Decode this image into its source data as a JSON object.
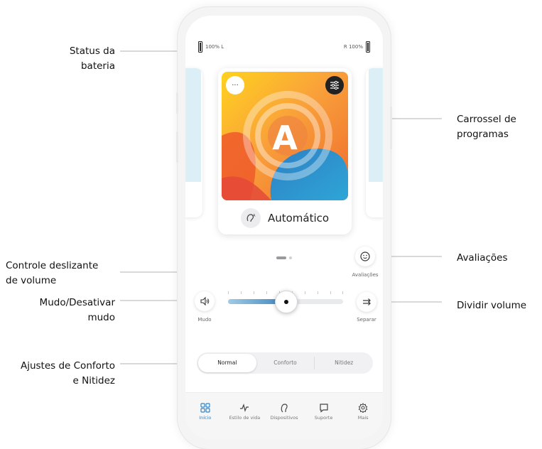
{
  "callouts": {
    "battery_status": "Status da\nbateria",
    "program_carousel": "Carrossel de\nprogramas",
    "ratings": "Avaliações",
    "volume_slider": "Controle deslizante\nde volume",
    "mute": "Mudo/Desativar\nmudo",
    "split_volume": "Dividir volume",
    "comfort_clarity": "Ajustes de Conforto\ne Nitidez"
  },
  "status": {
    "left_battery": "100% L",
    "right_battery": "R 100%"
  },
  "program": {
    "letter": "A",
    "name": "Automático",
    "menu_label": "···",
    "icons": {
      "menu": "ellipsis-icon",
      "settings": "sliders-icon",
      "program": "ear-auto-icon"
    }
  },
  "carousel": {
    "page_count": 2,
    "current_page": 1
  },
  "controls": {
    "ratings_label": "Avaliações",
    "mute_label": "Mudo",
    "split_label": "Separar",
    "volume_level": 0.5,
    "icons": {
      "ratings": "smiley-icon",
      "mute": "speaker-icon",
      "split": "split-arrows-icon"
    }
  },
  "modes": {
    "options": [
      "Normal",
      "Conforto",
      "Nitidez"
    ],
    "selected": "Normal"
  },
  "tabs": [
    {
      "label": "Início",
      "icon": "grid-icon",
      "active": true
    },
    {
      "label": "Estilo de vida",
      "icon": "activity-icon",
      "active": false
    },
    {
      "label": "Dispositivos",
      "icon": "hearing-aid-icon",
      "active": false
    },
    {
      "label": "Suporte",
      "icon": "chat-icon",
      "active": false
    },
    {
      "label": "Mais",
      "icon": "gear-icon",
      "active": false
    }
  ],
  "colors": {
    "accent": "#2f86c8",
    "slider_fill": "#3d86c0"
  }
}
